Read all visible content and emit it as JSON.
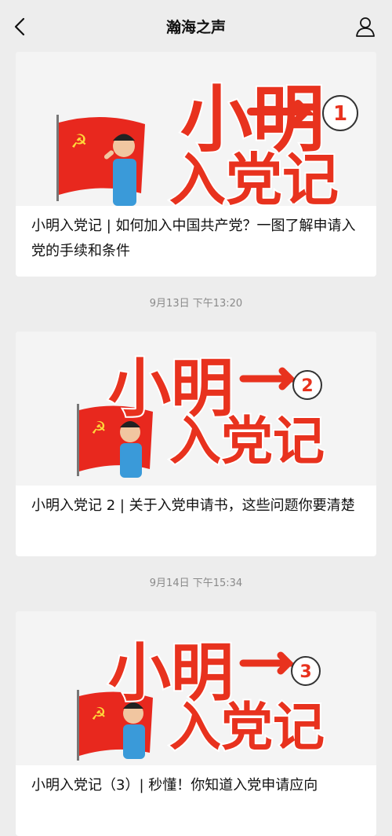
{
  "header": {
    "title": "瀚海之声"
  },
  "articles": [
    {
      "title": "小明入党记 | 如何加入中国共产党？一图了解申请入党的手续和条件",
      "cover": {
        "main": "小明",
        "sub": "入党记",
        "badge": "1"
      }
    },
    {
      "title": "小明入党记 2 | 关于入党申请书，这些问题你要清楚",
      "cover": {
        "main": "小明",
        "sub": "入党记",
        "badge": "2"
      }
    },
    {
      "title": "小明入党记（3）| 秒懂！你知道入党申请应向",
      "cover": {
        "main": "小明",
        "sub": "入党记",
        "badge": "3"
      }
    }
  ],
  "timestamps": [
    "9月13日 下午13:20",
    "9月14日 下午15:34"
  ],
  "icons": {
    "back": "chevron-left-icon",
    "profile": "user-icon"
  },
  "colors": {
    "accent_red": "#e8321e",
    "background": "#ededed"
  }
}
